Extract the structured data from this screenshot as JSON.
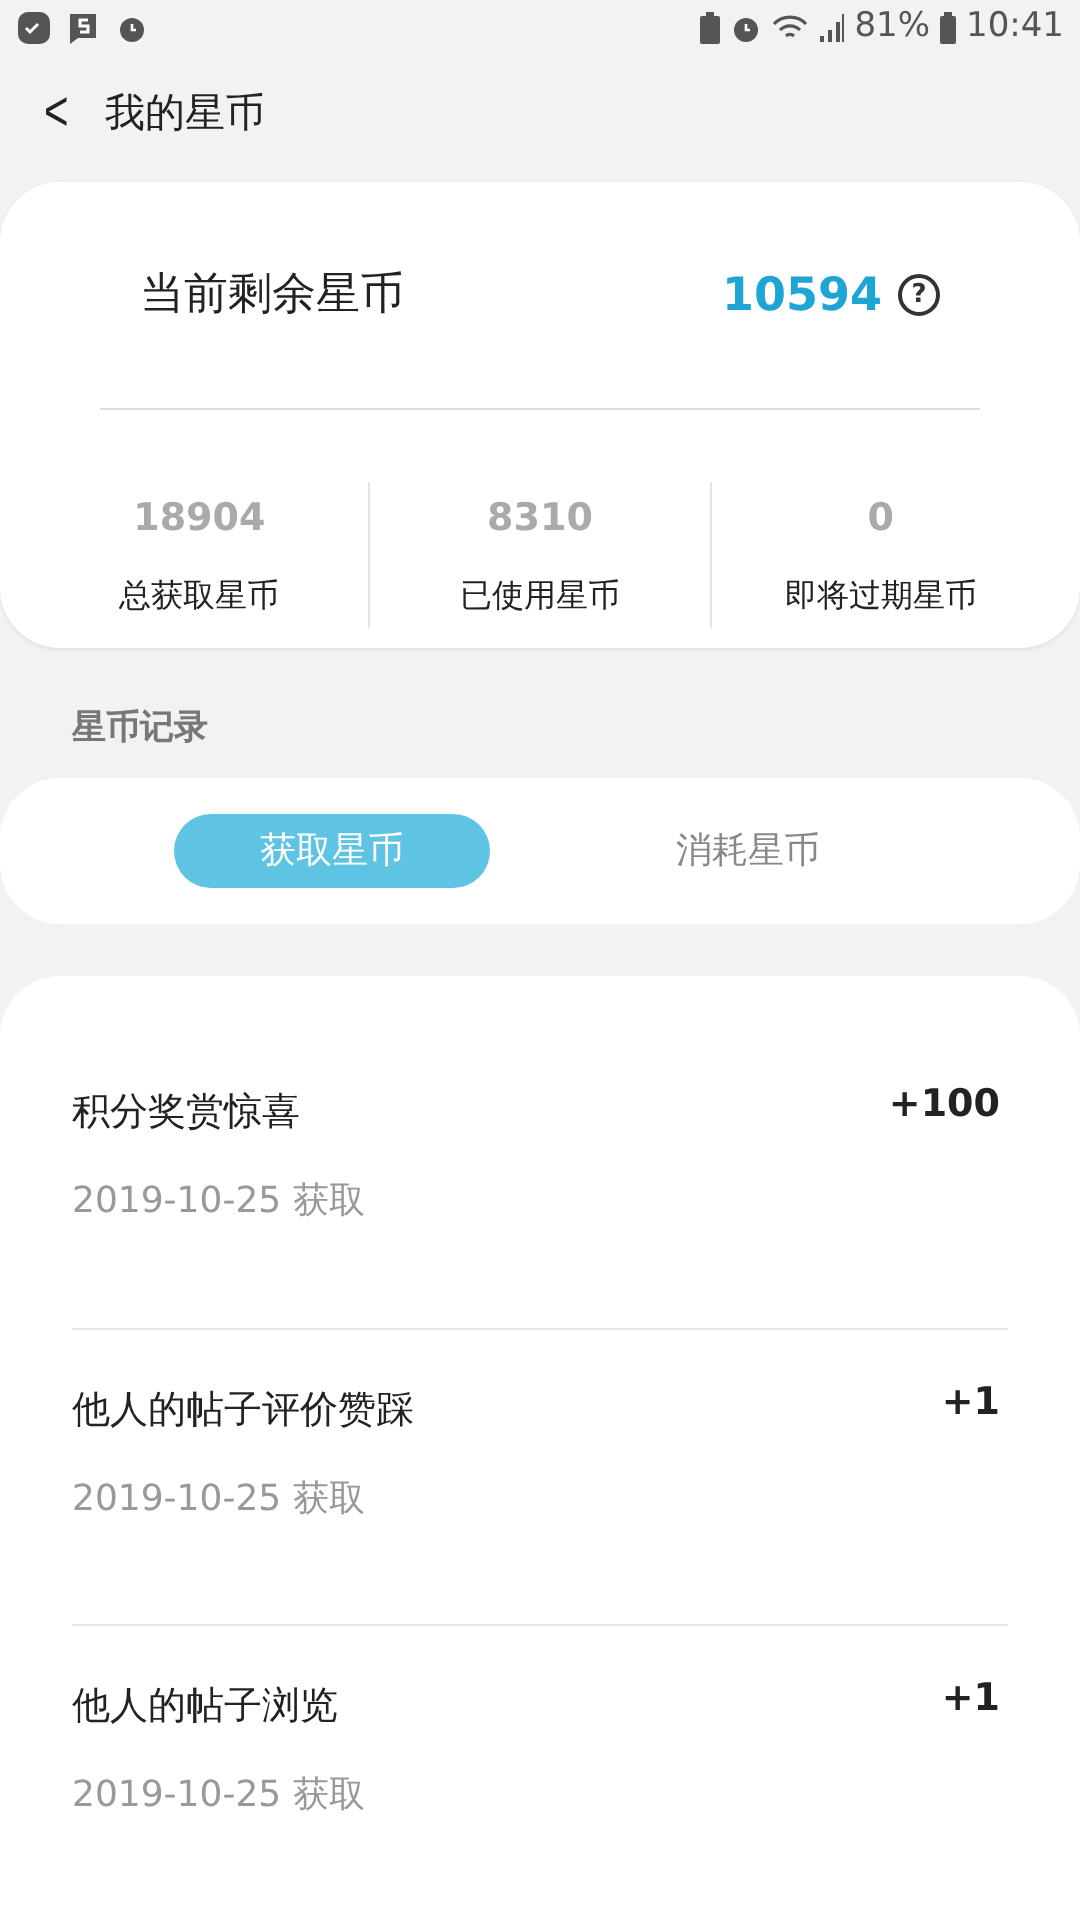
{
  "status_bar": {
    "battery_percent": "81%",
    "time": "10:41"
  },
  "header": {
    "back": "<",
    "title": "我的星币"
  },
  "balance": {
    "label": "当前剩余星币",
    "value": "10594",
    "help": "?"
  },
  "stats": [
    {
      "value": "18904",
      "label": "总获取星币"
    },
    {
      "value": "8310",
      "label": "已使用星币"
    },
    {
      "value": "0",
      "label": "即将过期星币"
    }
  ],
  "section_title": "星币记录",
  "tabs": [
    {
      "label": "获取星币",
      "selected": true
    },
    {
      "label": "消耗星币",
      "selected": false
    }
  ],
  "records": [
    {
      "title": "积分奖赏惊喜",
      "date": "2019-10-25 获取",
      "amount": "+100"
    },
    {
      "title": "他人的帖子评价赞踩",
      "date": "2019-10-25 获取",
      "amount": "+1"
    },
    {
      "title": "他人的帖子浏览",
      "date": "2019-10-25 获取",
      "amount": "+1"
    }
  ]
}
